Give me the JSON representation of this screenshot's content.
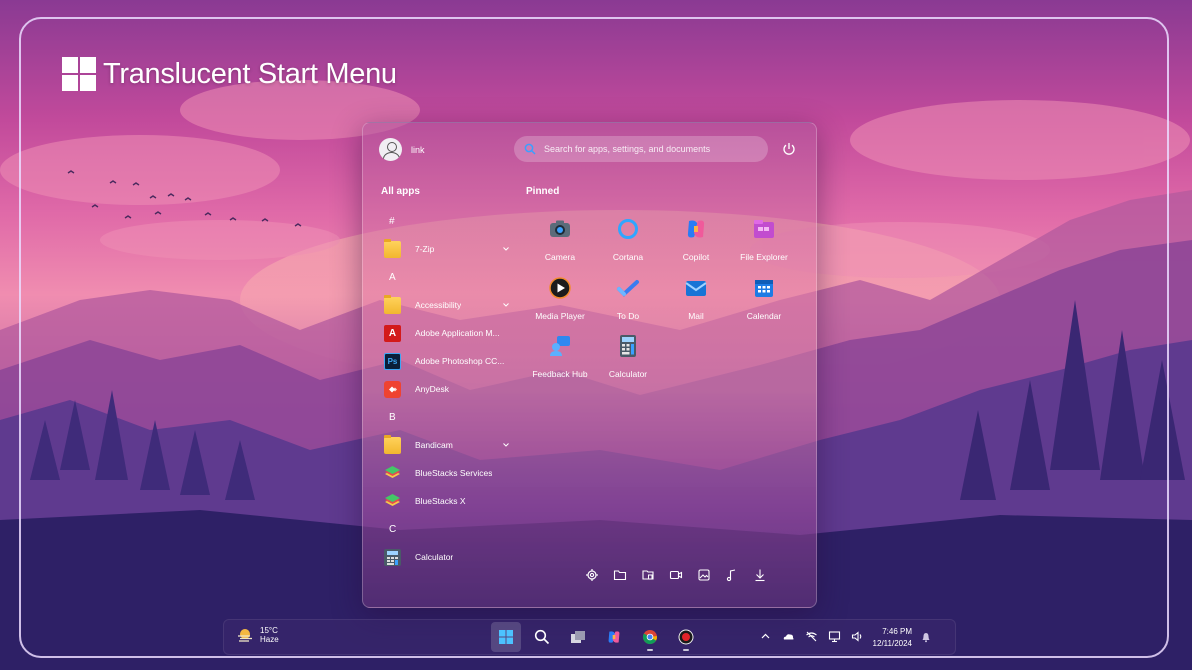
{
  "header": {
    "title": "Translucent Start Menu"
  },
  "start_menu": {
    "user": {
      "name": "link"
    },
    "search": {
      "placeholder": "Search for apps, settings, and documents"
    },
    "all_apps_label": "All apps",
    "pinned_label": "Pinned",
    "app_list": [
      {
        "type": "letter",
        "text": "#"
      },
      {
        "type": "app",
        "name": "7-Zip",
        "icon": "folder-icon",
        "expandable": true
      },
      {
        "type": "letter",
        "text": "A"
      },
      {
        "type": "app",
        "name": "Accessibility",
        "icon": "folder-icon",
        "expandable": true
      },
      {
        "type": "app",
        "name": "Adobe Application M...",
        "icon": "adobe-icon",
        "expandable": false
      },
      {
        "type": "app",
        "name": "Adobe Photoshop CC...",
        "icon": "photoshop-icon",
        "expandable": false
      },
      {
        "type": "app",
        "name": "AnyDesk",
        "icon": "anydesk-icon",
        "expandable": false
      },
      {
        "type": "letter",
        "text": "B"
      },
      {
        "type": "app",
        "name": "Bandicam",
        "icon": "folder-icon",
        "expandable": true
      },
      {
        "type": "app",
        "name": "BlueStacks Services",
        "icon": "bluestacks-icon",
        "expandable": false
      },
      {
        "type": "app",
        "name": "BlueStacks X",
        "icon": "bluestacks-icon",
        "expandable": false
      },
      {
        "type": "letter",
        "text": "C"
      },
      {
        "type": "app",
        "name": "Calculator",
        "icon": "calculator-icon",
        "expandable": false
      }
    ],
    "pinned": [
      {
        "name": "Camera",
        "icon": "camera-icon"
      },
      {
        "name": "Cortana",
        "icon": "cortana-icon"
      },
      {
        "name": "Copilot",
        "icon": "copilot-icon"
      },
      {
        "name": "File Explorer",
        "icon": "file-explorer-icon"
      },
      {
        "name": "Media Player",
        "icon": "media-player-icon"
      },
      {
        "name": "To Do",
        "icon": "todo-icon"
      },
      {
        "name": "Mail",
        "icon": "mail-icon"
      },
      {
        "name": "Calendar",
        "icon": "calendar-icon"
      },
      {
        "name": "Feedback Hub",
        "icon": "feedback-hub-icon"
      },
      {
        "name": "Calculator",
        "icon": "calculator-icon"
      }
    ],
    "quick_links": [
      "settings-icon",
      "file-explorer-folder-icon",
      "documents-icon",
      "videos-icon",
      "pictures-icon",
      "music-icon",
      "downloads-icon"
    ]
  },
  "taskbar": {
    "weather": {
      "temp": "15°C",
      "condition": "Haze"
    },
    "apps": [
      "start-icon",
      "search-icon",
      "task-view-icon",
      "copilot-icon",
      "chrome-icon",
      "record-icon"
    ],
    "tray": [
      "chevron-up-icon",
      "onedrive-icon",
      "network-off-icon",
      "display-icon",
      "volume-icon"
    ],
    "time": "7:46 PM",
    "date": "12/11/2024"
  },
  "colors": {
    "accent": "#3aa0ff",
    "frame": "#ebdcff"
  }
}
